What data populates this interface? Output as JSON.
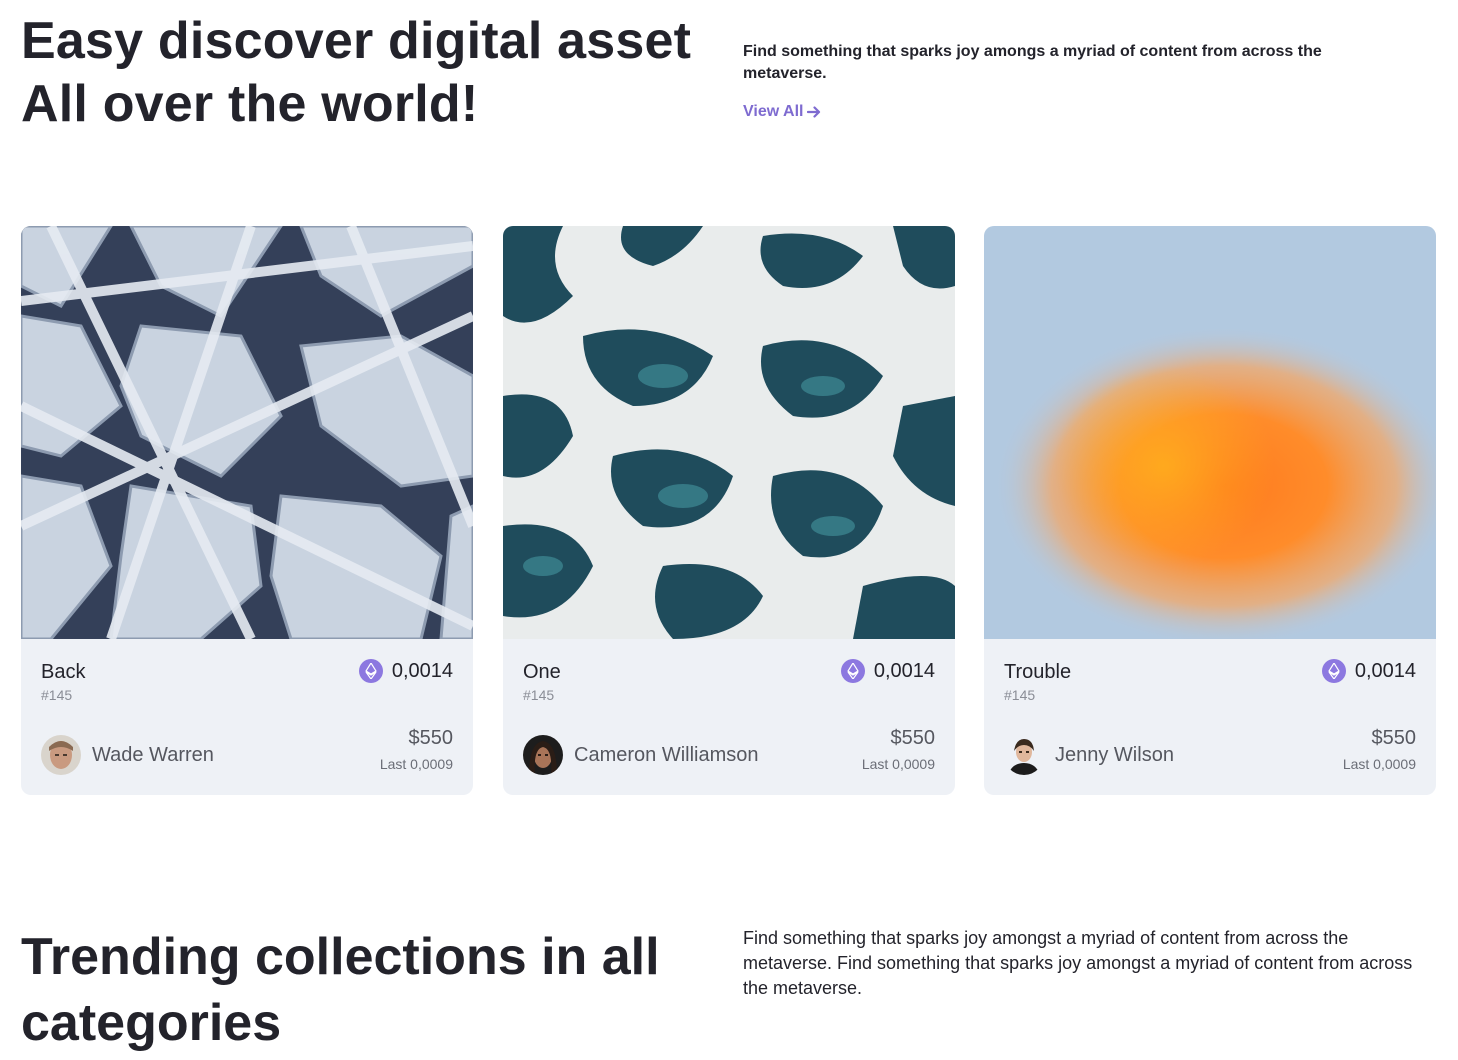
{
  "hero": {
    "title_line1": "Easy discover digital asset",
    "title_line2": "All over the world!",
    "description": "Find something that sparks joy amongs a myriad of content from across the metaverse.",
    "view_all_label": "View All"
  },
  "cards": [
    {
      "name": "Back",
      "id": "#145",
      "eth_price": "0,0014",
      "owner": "Wade Warren",
      "usd_price": "$550",
      "last": "Last 0,0009"
    },
    {
      "name": "One",
      "id": "#145",
      "eth_price": "0,0014",
      "owner": "Cameron Williamson",
      "usd_price": "$550",
      "last": "Last 0,0009"
    },
    {
      "name": "Trouble",
      "id": "#145",
      "eth_price": "0,0014",
      "owner": "Jenny Wilson",
      "usd_price": "$550",
      "last": "Last 0,0009"
    }
  ],
  "trending": {
    "title": "Trending collections in all categories",
    "description": "Find something that sparks joy amongst a myriad of content from across the metaverse. Find something that sparks joy amongst a myriad of content from across the metaverse."
  },
  "icons": {
    "view_all": "arrow-right-icon",
    "currency": "ethereum-icon"
  },
  "colors": {
    "accent": "#7e6bd0",
    "card_bg": "#eef1f6",
    "text_dark": "#23232b",
    "eth_badge": "#8c78e0"
  }
}
